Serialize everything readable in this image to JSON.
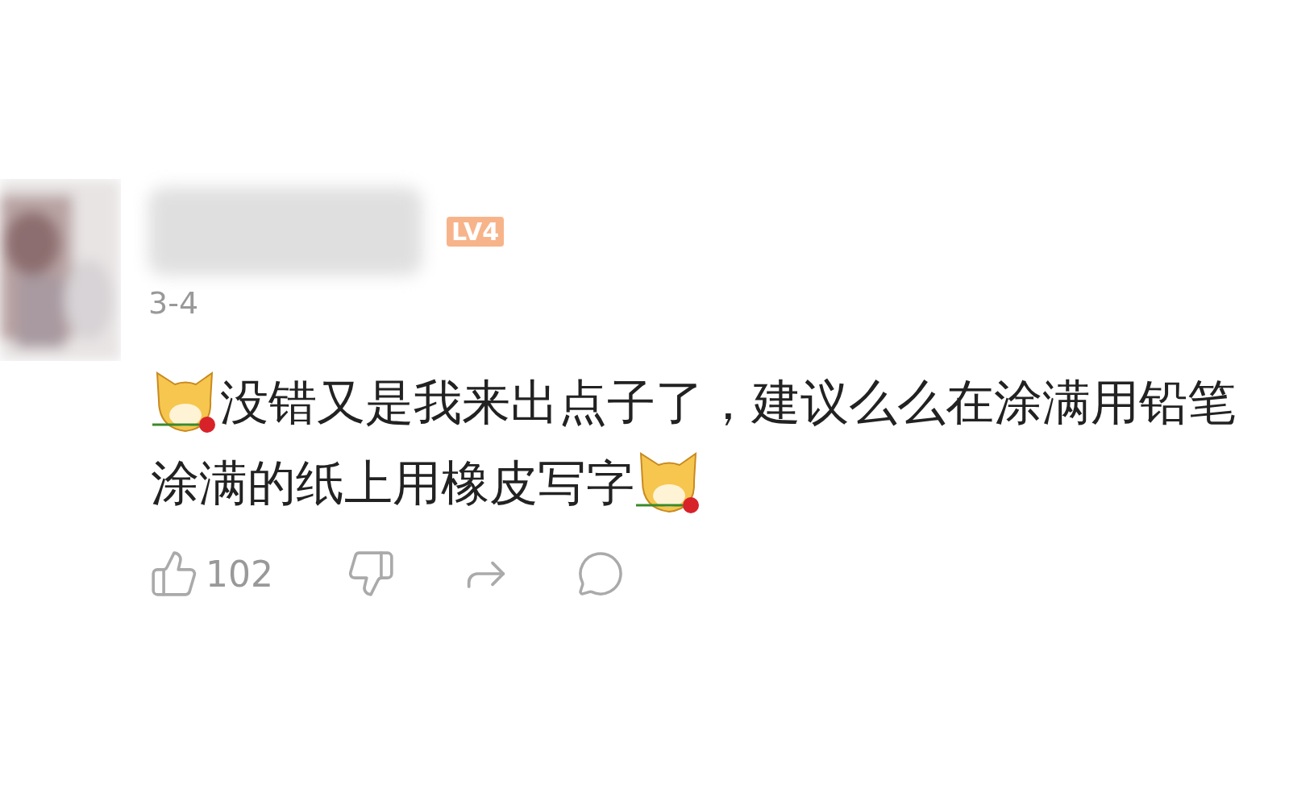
{
  "comment": {
    "level_badge": "LV4",
    "date": "3-4",
    "lines": [
      [
        {
          "kind": "emoji"
        },
        {
          "kind": "text",
          "text": "没错又是我来出点子了，建议么么在涂满用铅笔"
        }
      ],
      [
        {
          "kind": "text",
          "text": "涂满的纸上用橡皮写字"
        },
        {
          "kind": "emoji"
        }
      ]
    ],
    "likes": "102"
  }
}
